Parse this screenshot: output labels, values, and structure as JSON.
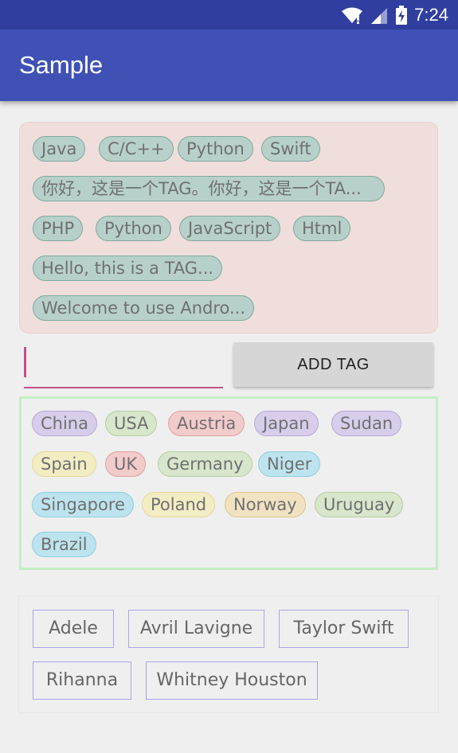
{
  "status_bar": {
    "time": "7:24",
    "icons": [
      "wifi-icon",
      "signal-icon",
      "battery-charging-icon"
    ]
  },
  "app_bar": {
    "title": "Sample"
  },
  "tag_group_1": {
    "tags": [
      "Java",
      "C/C++",
      "Python",
      "Swift",
      "你好，这是一个TAG。你好，这是一个TA...",
      "PHP",
      "Python",
      "JavaScript",
      "Html",
      "Hello, this is a TAG...",
      "Welcome to use Andro..."
    ],
    "colors": {
      "background": "#f0dedd",
      "tag_fill": "#b7d1ca",
      "tag_border": "#7fa99d"
    }
  },
  "input_row": {
    "tag_input_value": "",
    "add_button_label": "ADD TAG"
  },
  "tag_group_2": {
    "tags": [
      {
        "label": "China",
        "color": "purple"
      },
      {
        "label": "USA",
        "color": "green"
      },
      {
        "label": "Austria",
        "color": "red"
      },
      {
        "label": "Japan",
        "color": "purple"
      },
      {
        "label": "Sudan",
        "color": "purple"
      },
      {
        "label": "Spain",
        "color": "yellow"
      },
      {
        "label": "UK",
        "color": "red"
      },
      {
        "label": "Germany",
        "color": "green"
      },
      {
        "label": "Niger",
        "color": "cyan"
      },
      {
        "label": "Singapore",
        "color": "cyan"
      },
      {
        "label": "Poland",
        "color": "yellow"
      },
      {
        "label": "Norway",
        "color": "orange"
      },
      {
        "label": "Uruguay",
        "color": "green"
      },
      {
        "label": "Brazil",
        "color": "cyan"
      }
    ],
    "palette": {
      "purple": {
        "fill": "#d8cdea",
        "border": "#b8a8d8"
      },
      "green": {
        "fill": "#d8e6cc",
        "border": "#b6cf9f"
      },
      "red": {
        "fill": "#f2cbcb",
        "border": "#e0a0a0"
      },
      "yellow": {
        "fill": "#f3edc4",
        "border": "#e4da9a"
      },
      "cyan": {
        "fill": "#bde4ee",
        "border": "#8ecfe0"
      },
      "orange": {
        "fill": "#f1e3c2",
        "border": "#dfc58c"
      }
    },
    "border_color": "#c4efc4"
  },
  "tag_group_3": {
    "tags": [
      "Adele",
      "Avril Lavigne",
      "Taylor Swift",
      "Rihanna",
      "Whitney Houston"
    ],
    "border_color": "#aaa6ea"
  }
}
